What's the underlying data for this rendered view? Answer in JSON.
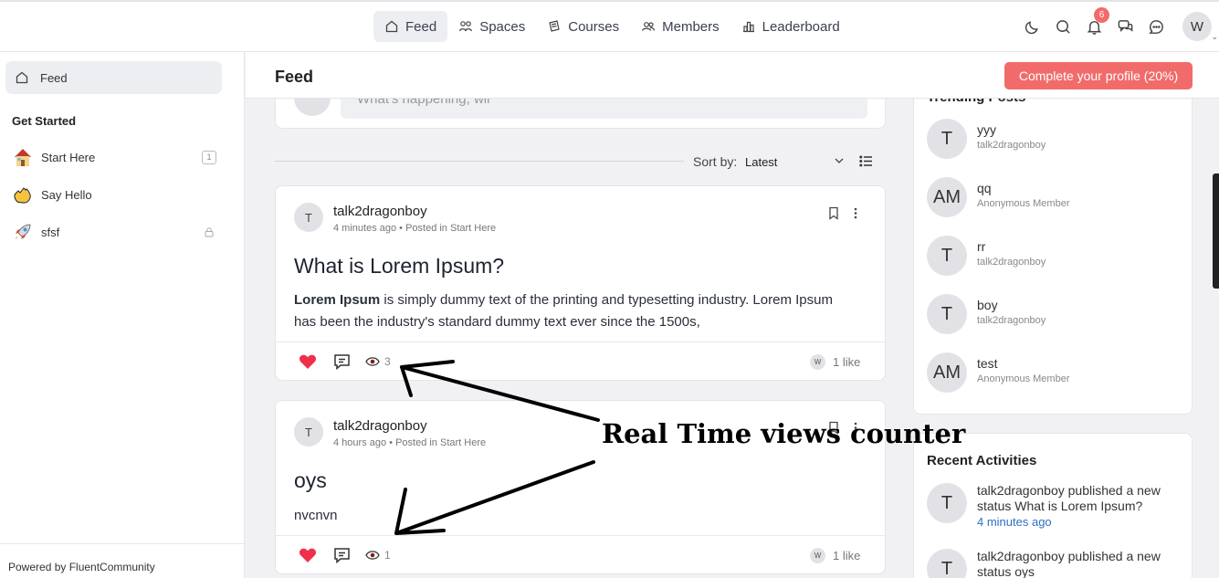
{
  "nav": {
    "items": [
      {
        "label": "Feed",
        "icon": "home-icon",
        "active": true
      },
      {
        "label": "Spaces",
        "icon": "spaces-icon"
      },
      {
        "label": "Courses",
        "icon": "courses-icon"
      },
      {
        "label": "Members",
        "icon": "members-icon"
      },
      {
        "label": "Leaderboard",
        "icon": "leaderboard-icon"
      }
    ],
    "notification_count": "6",
    "user_initial": "W"
  },
  "sidebar": {
    "feed_label": "Feed",
    "section_heading": "Get Started",
    "items": [
      {
        "label": "Start Here",
        "icon": "house-emoji-icon",
        "count": "1"
      },
      {
        "label": "Say Hello",
        "icon": "waving-hand-emoji-icon"
      },
      {
        "label": "sfsf",
        "icon": "rocket-emoji-icon",
        "locked": true
      }
    ],
    "powered_by": "Powered by FluentCommunity"
  },
  "header": {
    "title": "Feed",
    "complete_profile": "Complete your profile (20%)"
  },
  "composer": {
    "avatar": "W",
    "placeholder": "What's happening, wil"
  },
  "sort": {
    "label": "Sort by:",
    "value": "Latest"
  },
  "posts": [
    {
      "avatar": "T",
      "author": "talk2dragonboy",
      "meta": "4 minutes ago • Posted in Start Here",
      "title": "What is Lorem Ipsum?",
      "body_bold": "Lorem Ipsum",
      "body_rest": " is simply dummy text of the printing and typesetting industry. Lorem Ipsum has been the industry's standard dummy text ever since the 1500s,",
      "views": "3",
      "like_avatar": "W",
      "likes": "1 like"
    },
    {
      "avatar": "T",
      "author": "talk2dragonboy",
      "meta": "4 hours ago • Posted in Start Here",
      "title": "oys",
      "body_bold": "",
      "body_rest": "nvcnvn",
      "views": "1",
      "like_avatar": "W",
      "likes": "1 like"
    }
  ],
  "trending": {
    "title": "Trending Posts",
    "items": [
      {
        "avatar": "T",
        "name": "yyy",
        "sub": "talk2dragonboy"
      },
      {
        "avatar": "AM",
        "name": "qq",
        "sub": "Anonymous Member"
      },
      {
        "avatar": "T",
        "name": "rr",
        "sub": "talk2dragonboy"
      },
      {
        "avatar": "T",
        "name": "boy",
        "sub": "talk2dragonboy"
      },
      {
        "avatar": "AM",
        "name": "test",
        "sub": "Anonymous Member"
      }
    ]
  },
  "recent": {
    "title": "Recent Activities",
    "items": [
      {
        "avatar": "T",
        "text": "talk2dragonboy published a new status What is Lorem Ipsum?",
        "time": "4 minutes ago"
      },
      {
        "avatar": "T",
        "text": "talk2dragonboy published a new status oys",
        "time": ""
      }
    ]
  },
  "annotation": {
    "text": "Real Time views counter"
  },
  "colors": {
    "accent": "#f26b6b",
    "heart": "#f0304a",
    "link": "#2f6fbf"
  }
}
